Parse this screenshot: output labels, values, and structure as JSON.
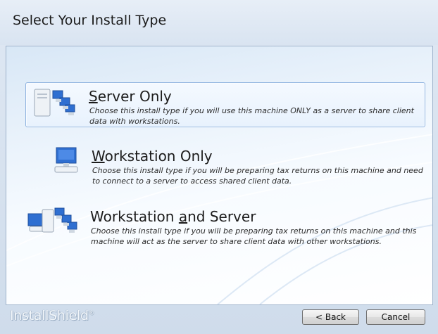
{
  "header": {
    "title": "Select Your Install Type"
  },
  "options": [
    {
      "title_prefix": "",
      "title_accel": "S",
      "title_rest": "erver Only",
      "description": "Choose this install type if you will use this machine ONLY as a server to share client data with workstations.",
      "selected": true,
      "icon": "server-network-icon"
    },
    {
      "title_prefix": "",
      "title_accel": "W",
      "title_rest": "orkstation Only",
      "description": "Choose this install type if you will be preparing tax returns on this machine and need to connect to a server to access shared client data.",
      "selected": false,
      "icon": "workstation-icon"
    },
    {
      "title_prefix": "Workstation ",
      "title_accel": "a",
      "title_rest": "nd Server",
      "description": "Choose this install type if you will be preparing tax returns on this machine and this machine will act as the server to share client data with other workstations.",
      "selected": false,
      "icon": "workstation-server-icon"
    }
  ],
  "footer": {
    "brand": "InstallShield",
    "brand_mark": "®",
    "back_label": "< Back",
    "cancel_label": "Cancel"
  },
  "colors": {
    "selection_border": "#8fb3e0",
    "header_bg": "#e7eef7"
  }
}
